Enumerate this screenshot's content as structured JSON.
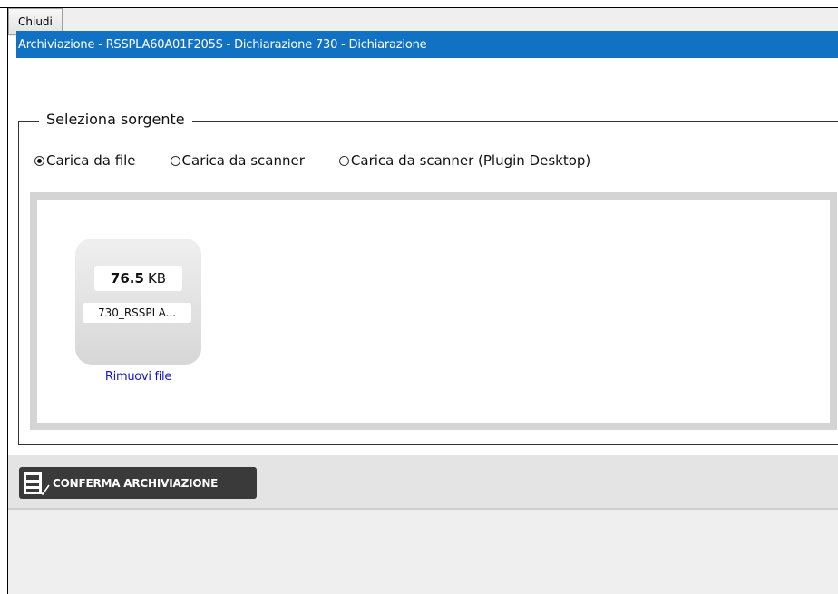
{
  "toolbar": {
    "close_label": "Chiudi"
  },
  "title_bar": {
    "text": "Archiviazione - RSSPLA60A01F205S - Dichiarazione 730 - Dichiarazione"
  },
  "source": {
    "legend": "Seleziona sorgente",
    "options": [
      {
        "label": "Carica da file",
        "checked": true
      },
      {
        "label": "Carica da scanner",
        "checked": false
      },
      {
        "label": "Carica da scanner (Plugin Desktop)",
        "checked": false
      }
    ]
  },
  "file": {
    "size_value": "76.5",
    "size_unit": "KB",
    "name": "730_RSSPLA...",
    "remove_label": "Rimuovi file"
  },
  "actions": {
    "confirm_label": "CONFERMA ARCHIVIAZIONE",
    "confirm_icon": "archive-save-icon"
  },
  "colors": {
    "title_bar": "#1172c4",
    "link": "#1515cc",
    "confirm_button": "#3a3a3a"
  }
}
